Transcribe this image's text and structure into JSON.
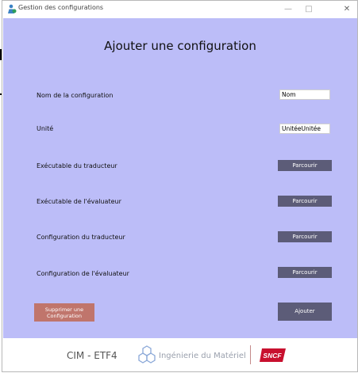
{
  "window": {
    "title": "Gestion des configurations",
    "minimize": "—",
    "maximize": "□",
    "close": "✕"
  },
  "form": {
    "heading": "Ajouter une configuration",
    "fields": {
      "name_label": "Nom de la configuration",
      "name_value": "Nom",
      "unit_label": "Unité",
      "unit_value": "UnitéeUnitée"
    },
    "browse_rows": [
      {
        "label": "Exécutable du traducteur",
        "button": "Parcourir"
      },
      {
        "label": "Exécutable de l'évaluateur",
        "button": "Parcourir"
      },
      {
        "label": "Configuration du traducteur",
        "button": "Parcourir"
      },
      {
        "label": "Configuration de l'évaluateur",
        "button": "Parcourir"
      }
    ],
    "delete_button": {
      "line1": "Supprimer une",
      "line2": "Configuration"
    },
    "add_button": "Ajouter"
  },
  "footer": {
    "cim": "CIM - ETF4",
    "ingenierie": "Ingénierie du Matériel",
    "sncf": "SNCF"
  },
  "colors": {
    "content_bg": "#bcbdf8",
    "button": "#5c5c78",
    "delete_button": "#c0756c",
    "sncf_red": "#c8102e"
  }
}
